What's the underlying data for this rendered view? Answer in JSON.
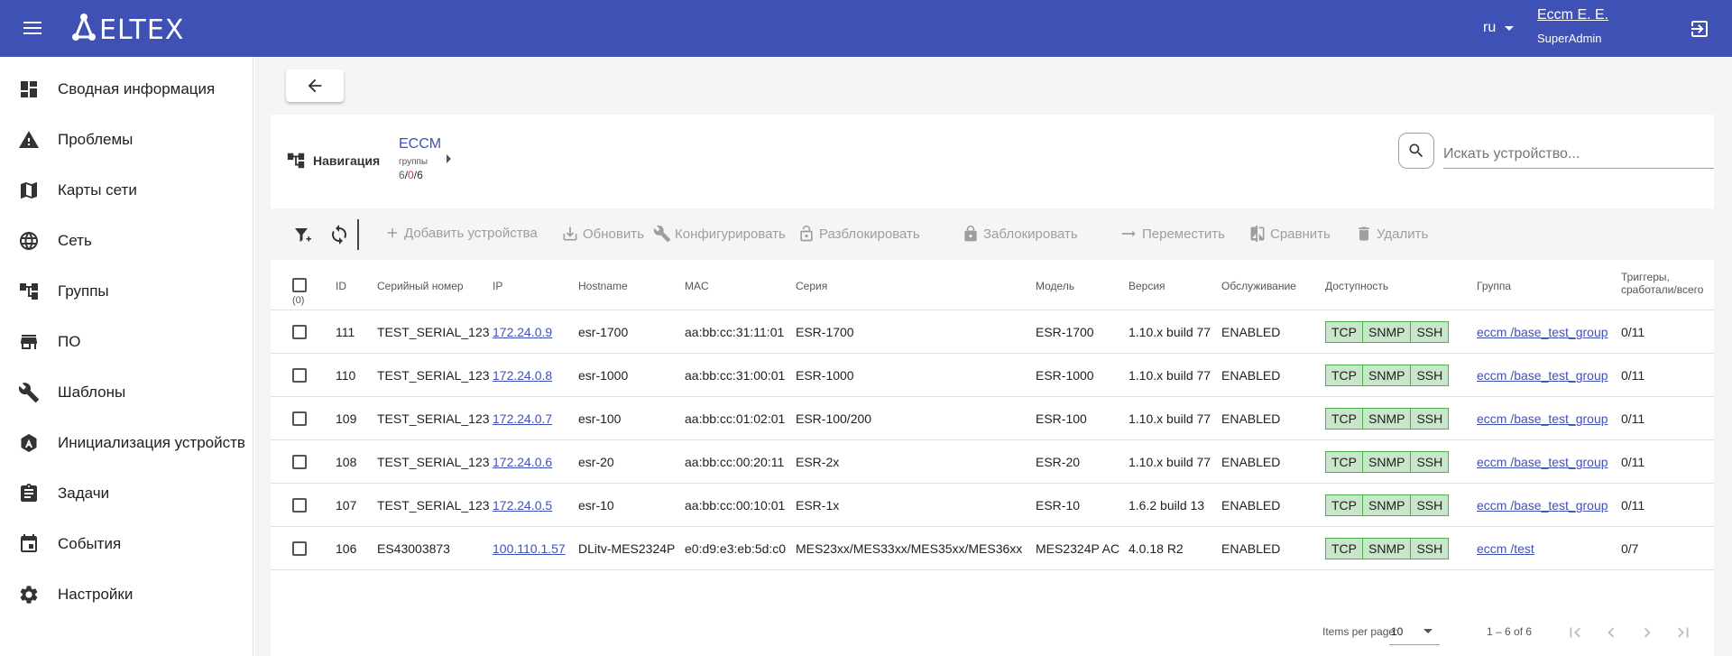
{
  "header": {
    "logo_text": "ELTEX",
    "language": "ru",
    "user_name": "Eccm E. E.",
    "user_role": "SuperAdmin"
  },
  "sidebar": {
    "items": [
      {
        "label": "Сводная информация",
        "icon": "dashboard-icon"
      },
      {
        "label": "Проблемы",
        "icon": "warning-icon"
      },
      {
        "label": "Карты сети",
        "icon": "map-icon"
      },
      {
        "label": "Сеть",
        "icon": "globe-icon"
      },
      {
        "label": "Группы",
        "icon": "groups-tree-icon"
      },
      {
        "label": "ПО",
        "icon": "store-icon"
      },
      {
        "label": "Шаблоны",
        "icon": "wrench-icon"
      },
      {
        "label": "Инициализация устройств",
        "icon": "device-init-icon"
      },
      {
        "label": "Задачи",
        "icon": "clipboard-icon"
      },
      {
        "label": "События",
        "icon": "calendar-icon"
      },
      {
        "label": "Настройки",
        "icon": "gear-icon"
      }
    ]
  },
  "navigation": {
    "label": "Навигация",
    "crumb_name": "ECCM",
    "crumb_sub": "группы",
    "count_green": "6",
    "count_red": "0",
    "count_total": "6",
    "sep": "/"
  },
  "search": {
    "placeholder": "Искать устройство..."
  },
  "toolbar": {
    "add": "Добавить устройства",
    "refresh": "Обновить",
    "configure": "Конфигурировать",
    "unlock": "Разблокировать",
    "lock": "Заблокировать",
    "move": "Переместить",
    "compare": "Сравнить",
    "delete": "Удалить"
  },
  "table": {
    "selected_count": "(0)",
    "columns": {
      "id": "ID",
      "serial": "Серийный номер",
      "ip": "IP",
      "hostname": "Hostname",
      "mac": "MAC",
      "series": "Серия",
      "model": "Модель",
      "version": "Версия",
      "service": "Обслуживание",
      "availability": "Доступность",
      "group": "Группа",
      "triggers_line1": "Триггеры,",
      "triggers_line2": "сработали/всего"
    },
    "availability_labels": [
      "TCP",
      "SNMP",
      "SSH"
    ],
    "rows": [
      {
        "id": "111",
        "serial": "TEST_SERIAL_123",
        "ip": "172.24.0.9",
        "hostname": "esr-1700",
        "mac": "aa:bb:cc:31:11:01",
        "series": "ESR-1700",
        "model": "ESR-1700",
        "version": "1.10.x build 77",
        "service": "ENABLED",
        "group": "eccm /base_test_group",
        "triggers": "0/11"
      },
      {
        "id": "110",
        "serial": "TEST_SERIAL_123",
        "ip": "172.24.0.8",
        "hostname": "esr-1000",
        "mac": "aa:bb:cc:31:00:01",
        "series": "ESR-1000",
        "model": "ESR-1000",
        "version": "1.10.x build 77",
        "service": "ENABLED",
        "group": "eccm /base_test_group",
        "triggers": "0/11"
      },
      {
        "id": "109",
        "serial": "TEST_SERIAL_123",
        "ip": "172.24.0.7",
        "hostname": "esr-100",
        "mac": "aa:bb:cc:01:02:01",
        "series": "ESR-100/200",
        "model": "ESR-100",
        "version": "1.10.x build 77",
        "service": "ENABLED",
        "group": "eccm /base_test_group",
        "triggers": "0/11"
      },
      {
        "id": "108",
        "serial": "TEST_SERIAL_123",
        "ip": "172.24.0.6",
        "hostname": "esr-20",
        "mac": "aa:bb:cc:00:20:11",
        "series": "ESR-2x",
        "model": "ESR-20",
        "version": "1.10.x build 77",
        "service": "ENABLED",
        "group": "eccm /base_test_group",
        "triggers": "0/11"
      },
      {
        "id": "107",
        "serial": "TEST_SERIAL_123",
        "ip": "172.24.0.5",
        "hostname": "esr-10",
        "mac": "aa:bb:cc:00:10:01",
        "series": "ESR-1x",
        "model": "ESR-10",
        "version": "1.6.2 build 13",
        "service": "ENABLED",
        "group": "eccm /base_test_group",
        "triggers": "0/11"
      },
      {
        "id": "106",
        "serial": "ES43003873",
        "ip": "100.110.1.57",
        "hostname": "DLitv-MES2324P",
        "mac": "e0:d9:e3:eb:5d:c0",
        "series": "MES23xx/MES33xx/MES35xx/MES36xx",
        "model": "MES2324P AC",
        "version": "4.0.18 R2",
        "service": "ENABLED",
        "group": "eccm /test",
        "triggers": "0/7"
      }
    ]
  },
  "pager": {
    "label": "Items per page:",
    "per_page": "10",
    "range": "1 – 6 of 6"
  },
  "colors": {
    "primary": "#3f51b5",
    "available_bg": "#c8e6c9",
    "available_border": "#4caf50"
  }
}
